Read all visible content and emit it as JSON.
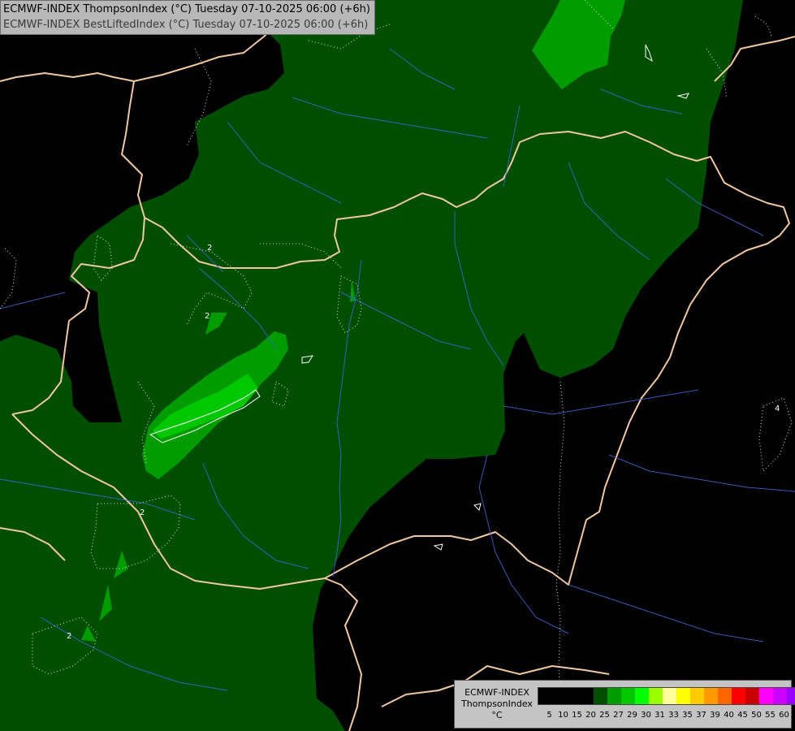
{
  "header": {
    "title_line1": "ECMWF-INDEX ThompsonIndex (°C) Tuesday 07-10-2025 06:00 (+6h)",
    "title_line2": "ECMWF-INDEX BestLiftedIndex (°C) Tuesday 07-10-2025 06:00 (+6h)"
  },
  "legend": {
    "line1": "ECMWF-INDEX",
    "line2": "ThompsonIndex",
    "line3": "°C",
    "colors": [
      "#000000",
      "#000000",
      "#000000",
      "#000000",
      "#004f00",
      "#009c00",
      "#00c800",
      "#00ff00",
      "#99ff00",
      "#ffff99",
      "#ffff00",
      "#ffcc00",
      "#ff9900",
      "#ff6600",
      "#ff0000",
      "#c80000",
      "#ff00ff",
      "#cc00ff",
      "#9900ff",
      "#6600ff",
      "#0000ff"
    ],
    "ticks": [
      "5",
      "10",
      "15",
      "20",
      "25",
      "27",
      "29",
      "30",
      "31",
      "33",
      "35",
      "37",
      "39",
      "40",
      "45",
      "50",
      "55",
      "60"
    ]
  },
  "map": {
    "colors": {
      "background": "#000000",
      "level_25": "#004f00",
      "level_27": "#009c00",
      "level_29": "#00c800",
      "borders": "#f0c8a0",
      "rivers": "#3c64c8",
      "contours": "#ffffff"
    },
    "contour_labels": [
      "2",
      "2",
      "2",
      "2",
      "4"
    ]
  }
}
